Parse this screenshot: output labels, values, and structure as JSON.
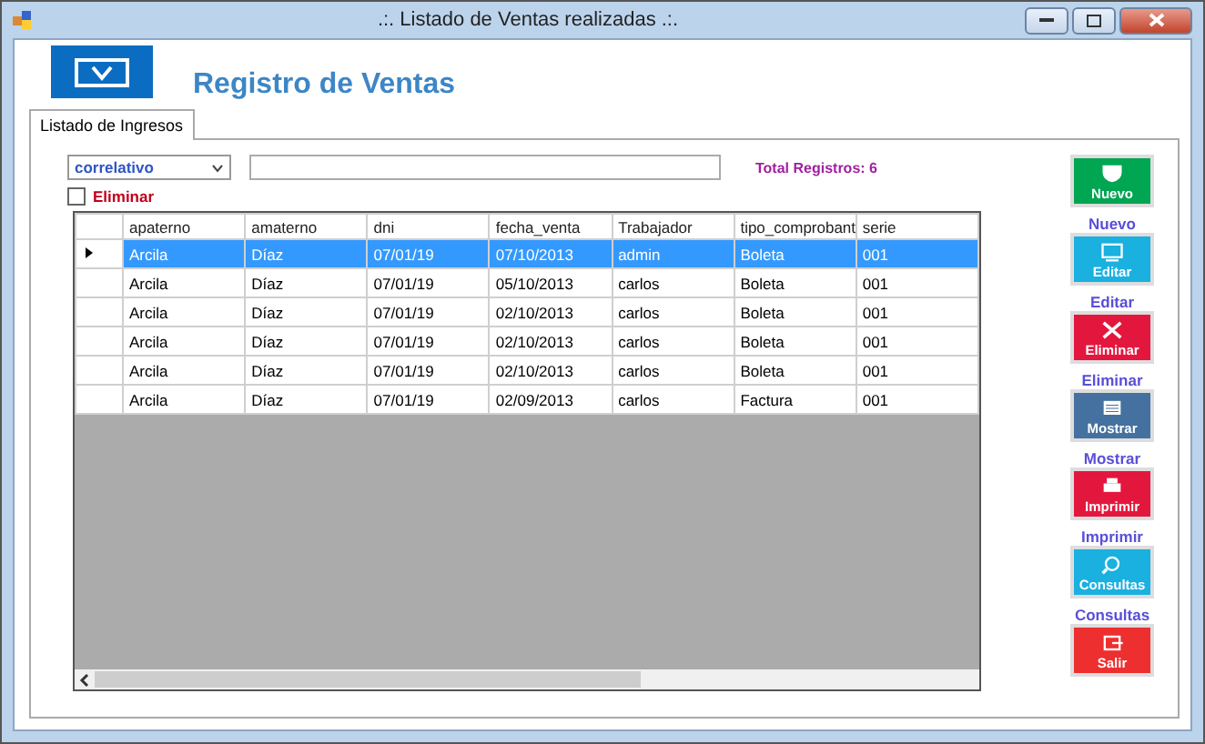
{
  "window": {
    "title": ".:. Listado de Ventas realizadas .:."
  },
  "header": {
    "title": "Registro de Ventas"
  },
  "tabs": [
    {
      "label": "Listado de Ingresos",
      "selected": true
    }
  ],
  "filter": {
    "field": "correlativo",
    "total": "Total Registros: 6"
  },
  "delete_checkbox": {
    "label": "Eliminar",
    "checked": false
  },
  "table": {
    "columns": [
      "apaterno",
      "amaterno",
      "dni",
      "fecha_venta",
      "Trabajador",
      "tipo_comprobant",
      "serie"
    ],
    "rows": [
      {
        "selected": true,
        "cells": [
          "Arcila",
          "Díaz",
          "07/01/19",
          "07/10/2013",
          "admin",
          "Boleta",
          "001"
        ]
      },
      {
        "selected": false,
        "cells": [
          "Arcila",
          "Díaz",
          "07/01/19",
          "05/10/2013",
          "carlos",
          "Boleta",
          "001"
        ]
      },
      {
        "selected": false,
        "cells": [
          "Arcila",
          "Díaz",
          "07/01/19",
          "02/10/2013",
          "carlos",
          "Boleta",
          "001"
        ]
      },
      {
        "selected": false,
        "cells": [
          "Arcila",
          "Díaz",
          "07/01/19",
          "02/10/2013",
          "carlos",
          "Boleta",
          "001"
        ]
      },
      {
        "selected": false,
        "cells": [
          "Arcila",
          "Díaz",
          "07/01/19",
          "02/10/2013",
          "carlos",
          "Boleta",
          "001"
        ]
      },
      {
        "selected": false,
        "cells": [
          "Arcila",
          "Díaz",
          "07/01/19",
          "02/09/2013",
          "carlos",
          "Factura",
          "001"
        ]
      }
    ]
  },
  "actions": [
    {
      "kind": "new",
      "button_text": "Nuevo",
      "label": "Nuevo"
    },
    {
      "kind": "edit",
      "button_text": "Editar",
      "label": "Editar"
    },
    {
      "kind": "delete",
      "button_text": "Eliminar",
      "label": "Eliminar"
    },
    {
      "kind": "show",
      "button_text": "Mostrar",
      "label": "Mostrar"
    },
    {
      "kind": "print",
      "button_text": "Imprimir",
      "label": "Imprimir"
    },
    {
      "kind": "query",
      "button_text": "Consultas",
      "label": "Consultas"
    },
    {
      "kind": "exit",
      "button_text": "Salir"
    }
  ]
}
